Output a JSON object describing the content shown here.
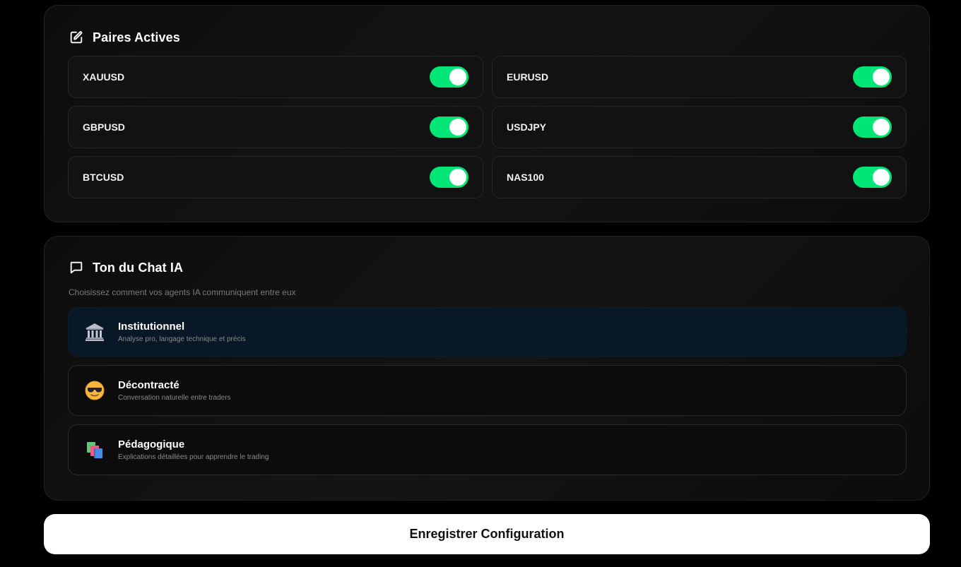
{
  "pairs_section": {
    "title": "Paires Actives",
    "icon": "edit-square-icon",
    "pairs": [
      {
        "label": "XAUUSD",
        "enabled": true
      },
      {
        "label": "EURUSD",
        "enabled": true
      },
      {
        "label": "GBPUSD",
        "enabled": true
      },
      {
        "label": "USDJPY",
        "enabled": true
      },
      {
        "label": "BTCUSD",
        "enabled": true
      },
      {
        "label": "NAS100",
        "enabled": true
      }
    ],
    "toggle_on_color": "#00e676"
  },
  "tone_section": {
    "title": "Ton du Chat IA",
    "icon": "chat-bubble-icon",
    "description": "Choisissez comment vos agents IA communiquent entre eux",
    "options": [
      {
        "name": "Institutionnel",
        "subtitle": "Analyse pro, langage technique et précis",
        "icon": "bank-building-icon",
        "selected": true
      },
      {
        "name": "Décontracté",
        "subtitle": "Conversation naturelle entre traders",
        "icon": "sunglasses-face-icon",
        "selected": false
      },
      {
        "name": "Pédagogique",
        "subtitle": "Explications détaillées pour apprendre le trading",
        "icon": "books-icon",
        "selected": false
      }
    ],
    "selected_color": "#081826"
  },
  "save_button": {
    "label": "Enregistrer Configuration"
  }
}
